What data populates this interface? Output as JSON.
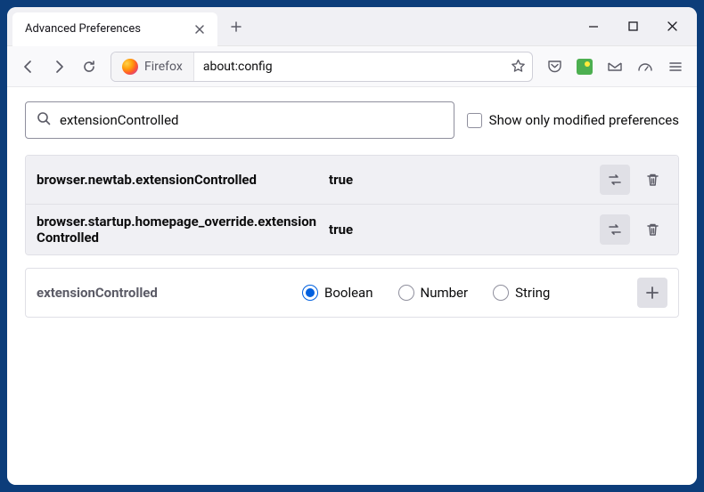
{
  "tab": {
    "title": "Advanced Preferences"
  },
  "urlbar": {
    "identity_label": "Firefox",
    "url": "about:config"
  },
  "search": {
    "value": "extensionControlled",
    "checkbox_label": "Show only modified preferences"
  },
  "prefs": [
    {
      "name": "browser.newtab.extensionControlled",
      "value": "true"
    },
    {
      "name": "browser.startup.homepage_override.extensionControlled",
      "value": "true"
    }
  ],
  "new_pref": {
    "name": "extensionControlled",
    "types": [
      "Boolean",
      "Number",
      "String"
    ],
    "selected": "Boolean"
  }
}
